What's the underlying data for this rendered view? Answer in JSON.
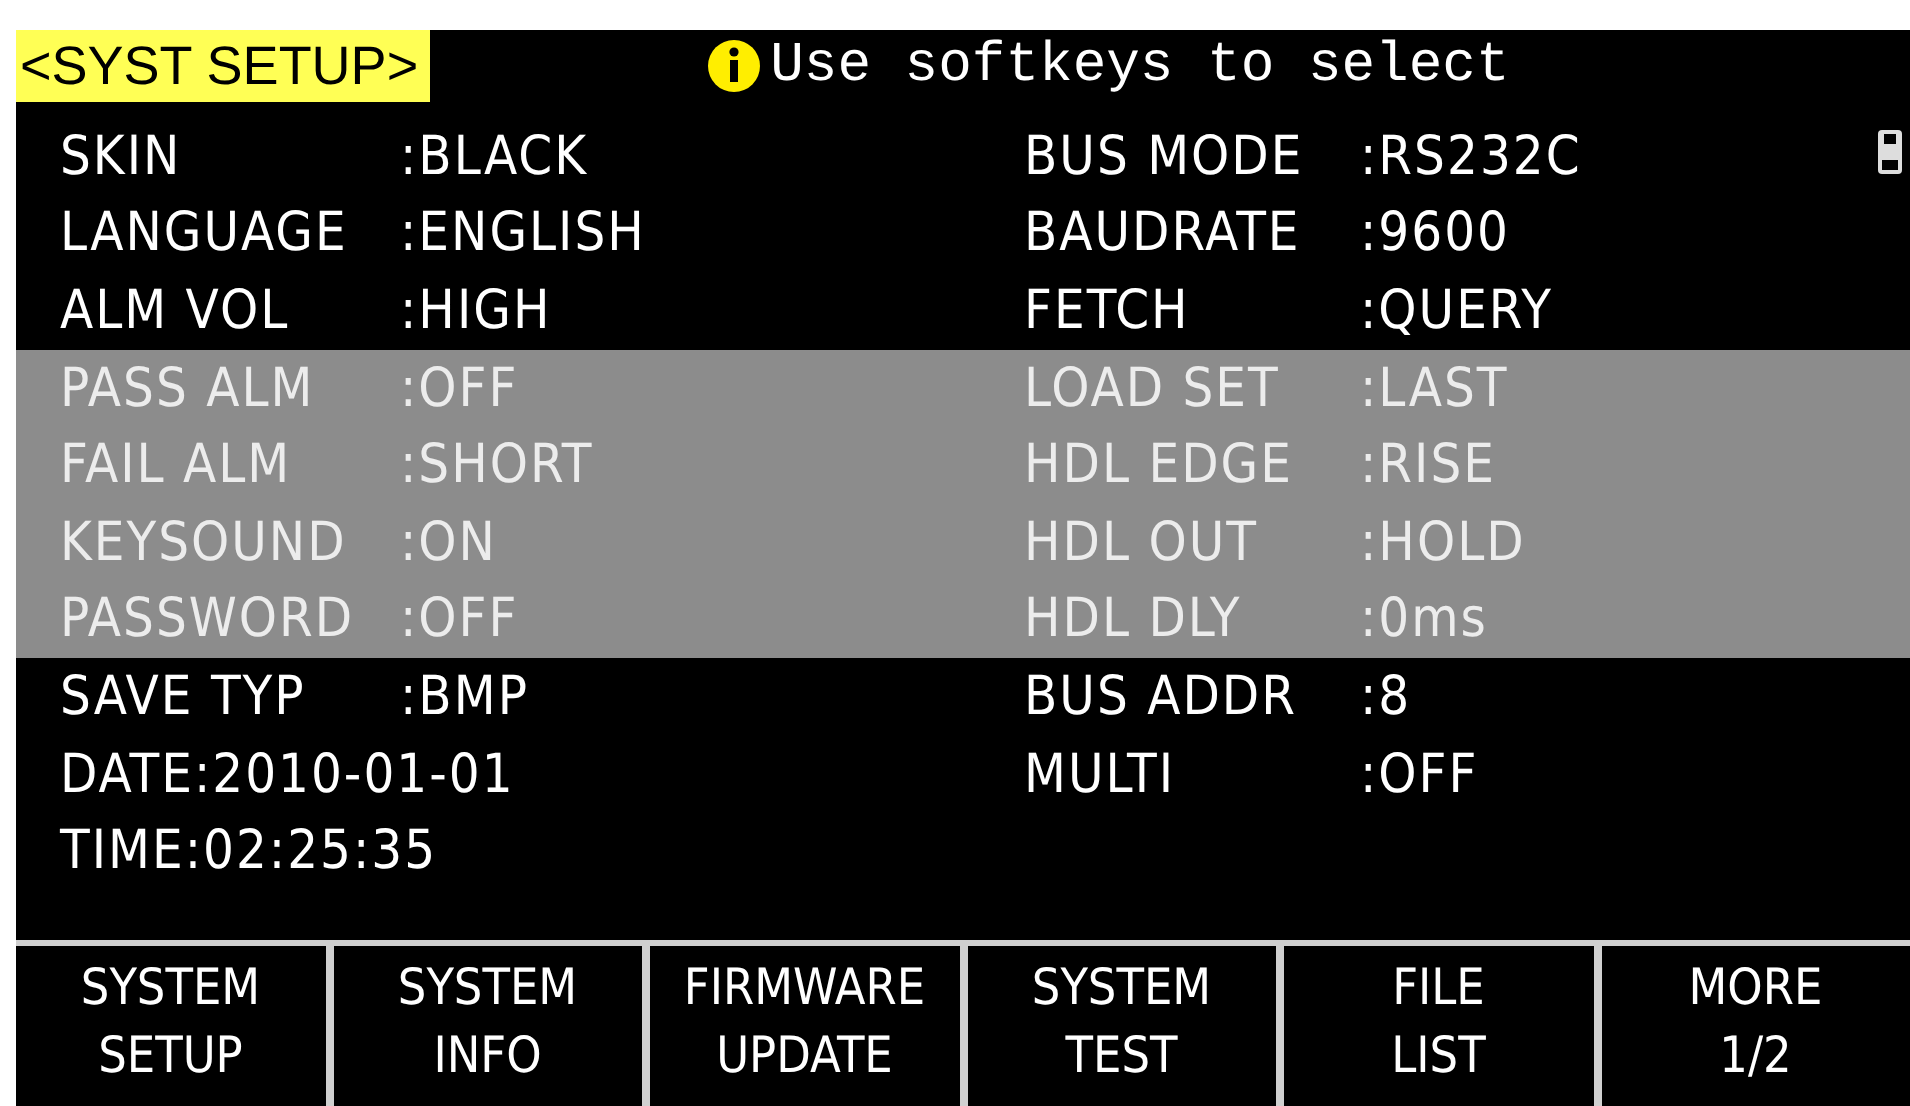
{
  "header": {
    "title": "<SYST SETUP>",
    "message": "Use softkeys to select"
  },
  "rows": [
    {
      "highlighted": false,
      "left": {
        "kind": "aligned",
        "label": "SKIN",
        "value": ":BLACK"
      },
      "right": {
        "label": "BUS MODE",
        "value": ":RS232C"
      }
    },
    {
      "highlighted": false,
      "left": {
        "kind": "aligned",
        "label": "LANGUAGE",
        "value": ":ENGLISH"
      },
      "right": {
        "label": "BAUDRATE",
        "value": ":9600"
      }
    },
    {
      "highlighted": false,
      "left": {
        "kind": "aligned",
        "label": "ALM VOL",
        "value": ":HIGH"
      },
      "right": {
        "label": "FETCH",
        "value": ":QUERY"
      }
    },
    {
      "highlighted": true,
      "left": {
        "kind": "aligned",
        "label": "PASS ALM",
        "value": ":OFF"
      },
      "right": {
        "label": "LOAD SET",
        "value": ":LAST"
      }
    },
    {
      "highlighted": true,
      "left": {
        "kind": "aligned",
        "label": "FAIL ALM",
        "value": ":SHORT"
      },
      "right": {
        "label": "HDL EDGE",
        "value": ":RISE"
      }
    },
    {
      "highlighted": true,
      "left": {
        "kind": "aligned",
        "label": "KEYSOUND",
        "value": ":ON"
      },
      "right": {
        "label": "HDL OUT",
        "value": ":HOLD"
      }
    },
    {
      "highlighted": true,
      "left": {
        "kind": "aligned",
        "label": "PASSWORD",
        "value": ":OFF"
      },
      "right": {
        "label": "HDL DLY",
        "value": ":0ms"
      }
    },
    {
      "highlighted": false,
      "left": {
        "kind": "aligned",
        "label": "SAVE TYP",
        "value": ":BMP"
      },
      "right": {
        "label": "BUS ADDR",
        "value": ":8"
      }
    },
    {
      "highlighted": false,
      "left": {
        "kind": "inline",
        "label": "DATE",
        "value": ":2010-01-01"
      },
      "right": {
        "label": "MULTI",
        "value": ":OFF"
      }
    },
    {
      "highlighted": false,
      "left": {
        "kind": "inline",
        "label": "TIME",
        "value": ":02:25:35"
      }
    }
  ],
  "softkeys": [
    [
      "SYSTEM",
      "SETUP"
    ],
    [
      "SYSTEM",
      "INFO"
    ],
    [
      "FIRMWARE",
      "UPDATE"
    ],
    [
      "SYSTEM",
      "TEST"
    ],
    [
      "FILE",
      "LIST"
    ],
    [
      "MORE",
      "1/2"
    ]
  ]
}
